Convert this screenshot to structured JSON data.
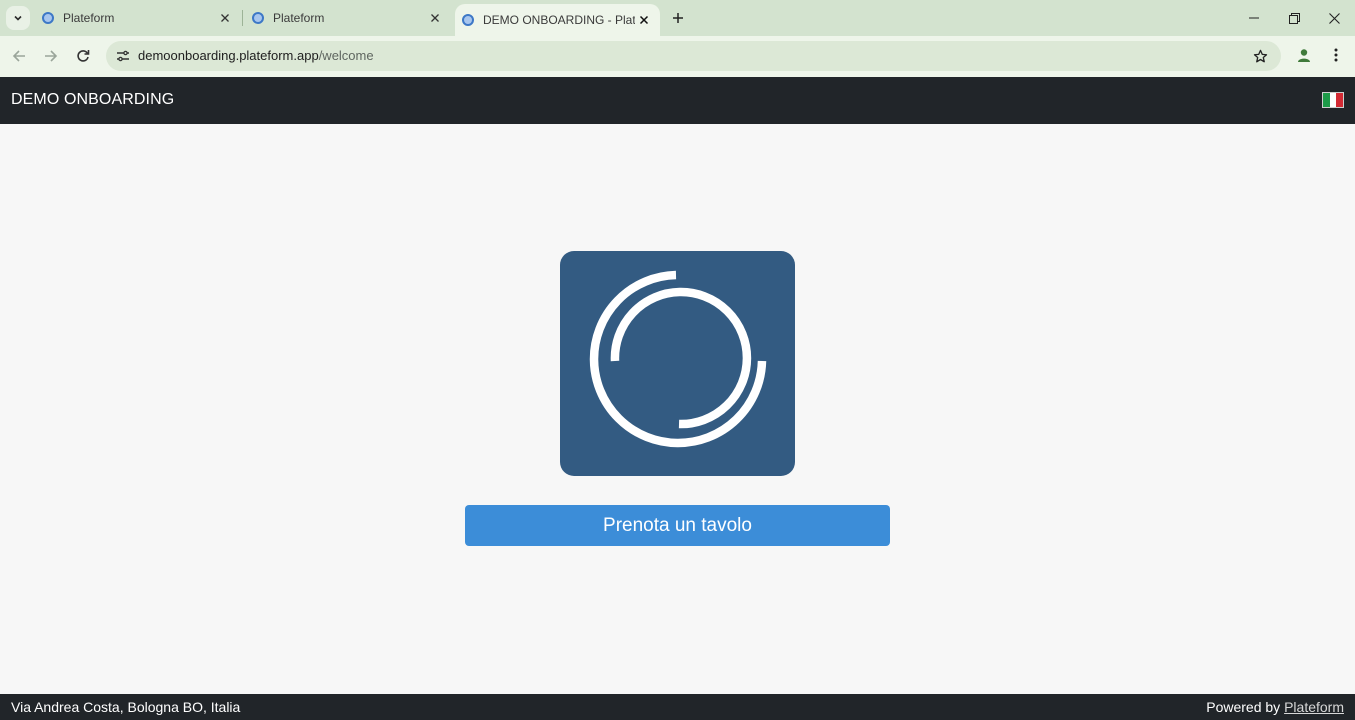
{
  "browser": {
    "tabs": [
      {
        "title": "Plateform",
        "active": false
      },
      {
        "title": "Plateform",
        "active": false
      },
      {
        "title": "DEMO ONBOARDING - Plateform",
        "active": true
      }
    ],
    "url_host": "demoonboarding.plateform.app",
    "url_path": "/welcome",
    "icons": [
      "tab-search-icon",
      "close-icon",
      "new-tab-icon",
      "minimize-icon",
      "restore-icon",
      "window-close-icon",
      "back-arrow-icon",
      "forward-arrow-icon",
      "reload-icon",
      "site-info-icon",
      "bookmark-star-icon",
      "profile-icon",
      "menu-kebab-icon"
    ]
  },
  "header": {
    "brand": "DEMO ONBOARDING",
    "language_flag": "italy-flag-icon"
  },
  "main": {
    "logo": "plateform-logo",
    "book_button_label": "Prenota un tavolo"
  },
  "footer": {
    "address": "Via Andrea Costa, Bologna BO, Italia",
    "powered_prefix": "Powered by ",
    "powered_link": "Plateform"
  },
  "colors": {
    "header_bg": "#212529",
    "logo_bg": "#335b82",
    "button_bg": "#3c8dd8",
    "page_bg": "#f7f7f7",
    "chrome_bg": "#d3e3cf"
  }
}
